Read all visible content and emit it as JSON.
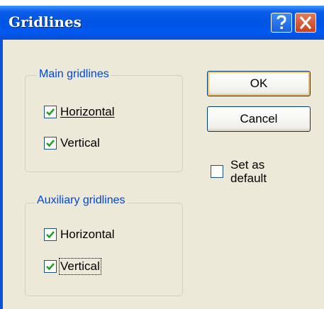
{
  "window": {
    "title": "Gridlines"
  },
  "titlebar_buttons": {
    "help_icon": "question-mark",
    "close_icon": "x-mark"
  },
  "main_gridlines": {
    "label": "Main gridlines",
    "horizontal": {
      "label": "Horizontal",
      "checked": true
    },
    "vertical": {
      "label": "Vertical",
      "checked": true
    }
  },
  "auxiliary_gridlines": {
    "label": "Auxiliary gridlines",
    "horizontal": {
      "label": "Horizontal",
      "checked": true
    },
    "vertical": {
      "label": "Vertical",
      "checked": true
    }
  },
  "buttons": {
    "ok": "OK",
    "cancel": "Cancel"
  },
  "set_as_default": {
    "line1": "Set as",
    "line2": "default",
    "checked": false
  },
  "colors": {
    "titlebar": "#0054e3",
    "legend": "#0046d5",
    "close": "#c8401c",
    "dialog_bg": "#ece9d8"
  }
}
